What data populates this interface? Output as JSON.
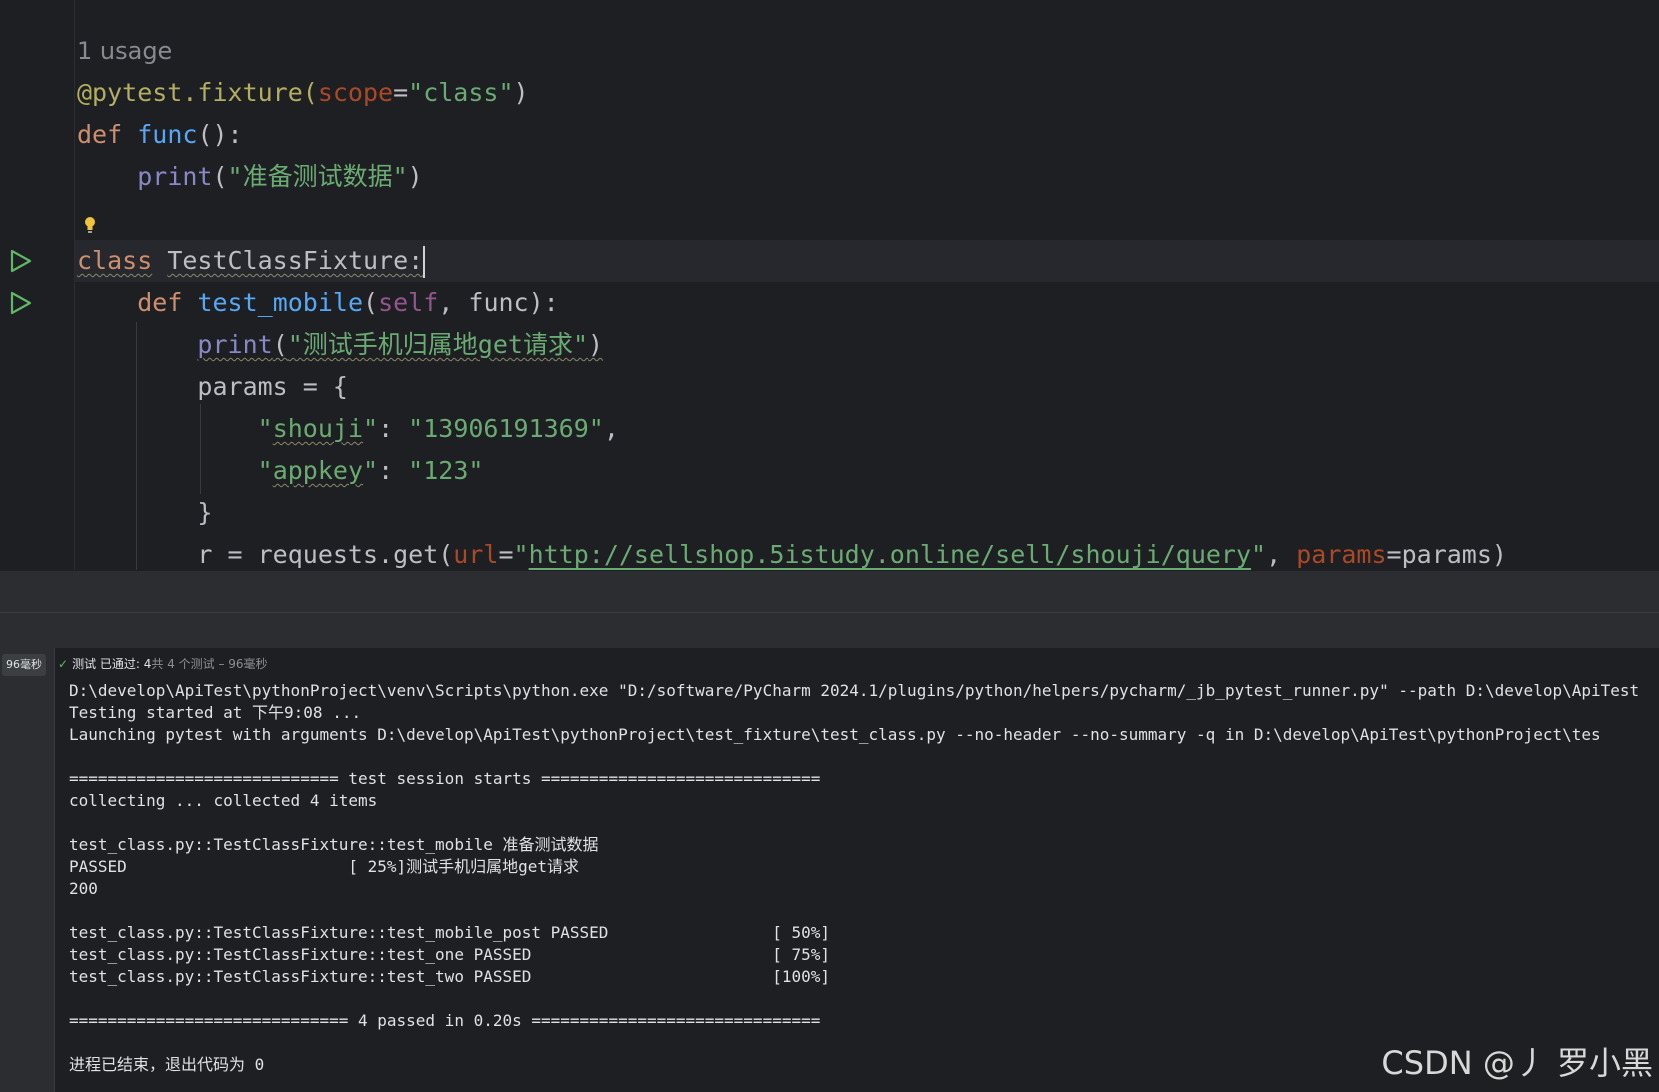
{
  "editor": {
    "usage_hint": "1 usage",
    "code": {
      "decorator": "@pytest.fixture(",
      "scope_param": "scope",
      "eq": "=",
      "scope_value": "\"class\"",
      "close_paren": ")",
      "def_kw": "def",
      "func_name": "func",
      "func_sig": "():",
      "print_fn": "print",
      "print_open": "(",
      "print1_str": "\"准备测试数据\"",
      "print_close": ")",
      "class_kw": "class",
      "class_name": "TestClassFixture:",
      "def2_kw": "def",
      "test_fn": "test_mobile",
      "open2": "(",
      "self_kw": "self",
      "args_rest": ", func):",
      "print2_str": "\"测试手机归属地get请求\"",
      "params_line": "params = {",
      "q1": "\"",
      "key1": "shouji",
      "q1b": "\"",
      "colon1": ": ",
      "val1": "\"13906191369\"",
      "comma1": ",",
      "q2": "\"",
      "key2": "appkey",
      "q2b": "\"",
      "colon2": ": ",
      "val2": "\"123\"",
      "brace_close": "}",
      "req_start": "r = requests.get(",
      "url_param": "url",
      "req_eq": "=",
      "url_q1": "\"",
      "url_value": "http://sellshop.5istudy.online/sell/shouji/query",
      "url_q2": "\"",
      "req_comma": ", ",
      "params_param": "params",
      "req_eq2": "=",
      "req_end": "params)"
    }
  },
  "run_panel": {
    "duration_badge": "96毫秒",
    "status_label": "测试 已通过: 4",
    "status_detail": "共 4 个测试 – 96毫秒",
    "console_lines": [
      "D:\\develop\\ApiTest\\pythonProject\\venv\\Scripts\\python.exe \"D:/software/PyCharm 2024.1/plugins/python/helpers/pycharm/_jb_pytest_runner.py\" --path D:\\develop\\ApiTest",
      "Testing started at 下午9:08 ...",
      "Launching pytest with arguments D:\\develop\\ApiTest\\pythonProject\\test_fixture\\test_class.py --no-header --no-summary -q in D:\\develop\\ApiTest\\pythonProject\\tes",
      "",
      "============================ test session starts =============================",
      "collecting ... collected 4 items",
      "",
      "test_class.py::TestClassFixture::test_mobile 准备测试数据",
      "PASSED                       [ 25%]测试手机归属地get请求",
      "200",
      "",
      "test_class.py::TestClassFixture::test_mobile_post PASSED                 [ 50%]",
      "test_class.py::TestClassFixture::test_one PASSED                         [ 75%]",
      "test_class.py::TestClassFixture::test_two PASSED                         [100%]",
      "",
      "============================= 4 passed in 0.20s ==============================",
      "",
      "进程已结束，退出代码为 0"
    ]
  },
  "watermark": "CSDN @丿 罗小黑",
  "colors": {
    "background": "#1e1f22",
    "keyword": "#cf8e6d",
    "function": "#56a8f5",
    "string": "#6aab73",
    "param": "#aa4926",
    "decorator": "#b3ae60",
    "run_icon": "#5fb865"
  },
  "icons": [
    "run-test-icon",
    "lightbulb-icon",
    "check-icon"
  ]
}
